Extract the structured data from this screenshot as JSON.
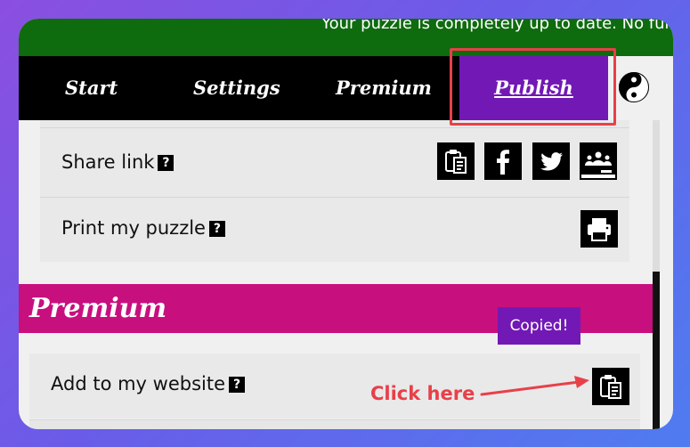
{
  "banner": {
    "text": "Your puzzle is completely up to date. No fur"
  },
  "nav": {
    "tabs": [
      {
        "label": "Start"
      },
      {
        "label": "Settings"
      },
      {
        "label": "Premium"
      },
      {
        "label": "Publish",
        "active": true
      }
    ]
  },
  "publish": {
    "share_link_label": "Share link",
    "print_label": "Print my puzzle",
    "help_mark": "?"
  },
  "premium": {
    "header": "Premium",
    "add_website_label": "Add to my website",
    "tooltip": "Copied!"
  },
  "annotation": {
    "click_here": "Click here"
  },
  "colors": {
    "banner": "#0e6b0e",
    "nav": "#000000",
    "active_tab": "#7219b5",
    "premium": "#c80f7e",
    "annotation": "#e8404a"
  },
  "icons": [
    "clipboard-icon",
    "facebook-icon",
    "twitter-icon",
    "classroom-icon",
    "printer-icon",
    "yin-yang-icon"
  ]
}
